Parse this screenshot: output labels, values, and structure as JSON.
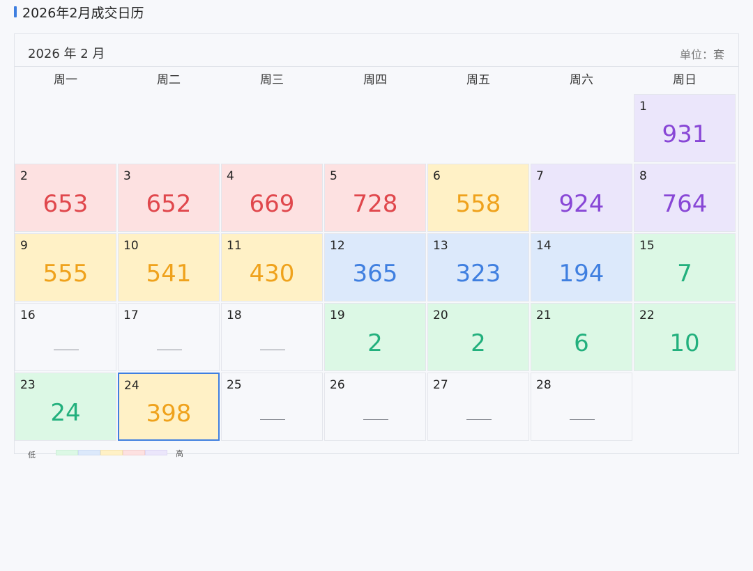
{
  "page": {
    "title": "2026年2月成交日历"
  },
  "calendar": {
    "month_label": "2026 年 2 月",
    "unit_label": "单位：套",
    "weekdays": [
      "周一",
      "周二",
      "周三",
      "周四",
      "周五",
      "周六",
      "周日"
    ],
    "empty_marker": "——",
    "selected_day": 24,
    "legend": {
      "low_label": "低",
      "high_label": "高",
      "swatches": [
        {
          "bg": "#dcf8e5",
          "border": "#cdeed8"
        },
        {
          "bg": "#dce9fb",
          "border": "#cddcf3"
        },
        {
          "bg": "#fff1c6",
          "border": "#f4e3b0"
        },
        {
          "bg": "#fde1e1",
          "border": "#f2cfcf"
        },
        {
          "bg": "#ebe6fb",
          "border": "#ddd6f3"
        }
      ]
    }
  },
  "colors": {
    "accent": "#3f7fe0",
    "levels": [
      {
        "name": "green",
        "bg": "#dcf8e5",
        "fg": "#22b07d"
      },
      {
        "name": "blue",
        "bg": "#dce9fb",
        "fg": "#3f7fe0"
      },
      {
        "name": "yellow",
        "bg": "#fff1c6",
        "fg": "#efa21c"
      },
      {
        "name": "red",
        "bg": "#fde1e1",
        "fg": "#e0474c"
      },
      {
        "name": "purple",
        "bg": "#ebe6fb",
        "fg": "#8847d6"
      }
    ],
    "empty_bg": "#f7f8fb"
  },
  "chart_data": {
    "type": "heatmap",
    "title": "2026年2月成交日历",
    "unit": "套",
    "first_weekday_index": 6,
    "days": [
      {
        "day": 1,
        "value": 931,
        "level": 4
      },
      {
        "day": 2,
        "value": 653,
        "level": 3
      },
      {
        "day": 3,
        "value": 652,
        "level": 3
      },
      {
        "day": 4,
        "value": 669,
        "level": 3
      },
      {
        "day": 5,
        "value": 728,
        "level": 3
      },
      {
        "day": 6,
        "value": 558,
        "level": 2
      },
      {
        "day": 7,
        "value": 924,
        "level": 4
      },
      {
        "day": 8,
        "value": 764,
        "level": 4
      },
      {
        "day": 9,
        "value": 555,
        "level": 2
      },
      {
        "day": 10,
        "value": 541,
        "level": 2
      },
      {
        "day": 11,
        "value": 430,
        "level": 2
      },
      {
        "day": 12,
        "value": 365,
        "level": 1
      },
      {
        "day": 13,
        "value": 323,
        "level": 1
      },
      {
        "day": 14,
        "value": 194,
        "level": 1
      },
      {
        "day": 15,
        "value": 7,
        "level": 0
      },
      {
        "day": 16,
        "value": null,
        "level": null
      },
      {
        "day": 17,
        "value": null,
        "level": null
      },
      {
        "day": 18,
        "value": null,
        "level": null
      },
      {
        "day": 19,
        "value": 2,
        "level": 0
      },
      {
        "day": 20,
        "value": 2,
        "level": 0
      },
      {
        "day": 21,
        "value": 6,
        "level": 0
      },
      {
        "day": 22,
        "value": 10,
        "level": 0
      },
      {
        "day": 23,
        "value": 24,
        "level": 0
      },
      {
        "day": 24,
        "value": 398,
        "level": 2
      },
      {
        "day": 25,
        "value": null,
        "level": null
      },
      {
        "day": 26,
        "value": null,
        "level": null
      },
      {
        "day": 27,
        "value": null,
        "level": null
      },
      {
        "day": 28,
        "value": null,
        "level": null
      }
    ]
  }
}
